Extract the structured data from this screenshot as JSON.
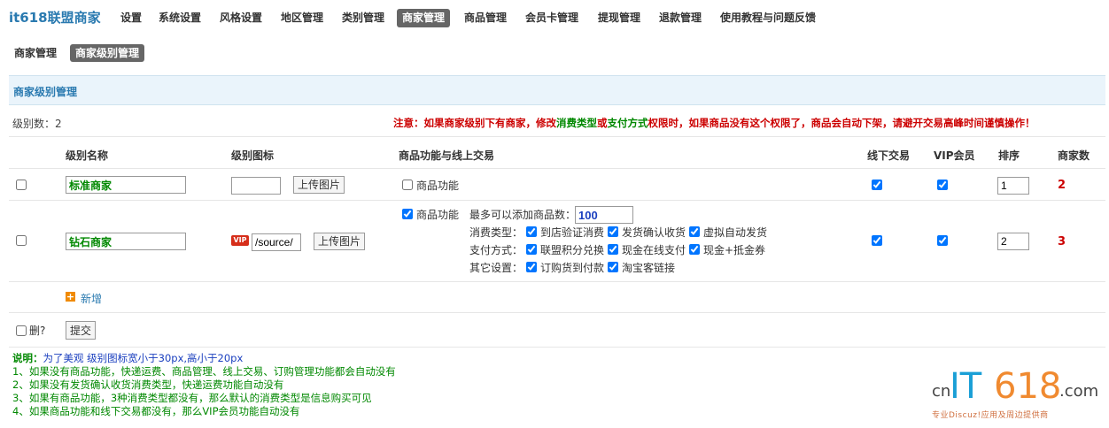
{
  "brand": "it618联盟商家",
  "nav": [
    "设置",
    "系统设置",
    "风格设置",
    "地区管理",
    "类别管理",
    "商家管理",
    "商品管理",
    "会员卡管理",
    "提现管理",
    "退款管理",
    "使用教程与问题反馈"
  ],
  "subnav": [
    "商家管理",
    "商家级别管理"
  ],
  "section_title": "商家级别管理",
  "level_count": "级别数：2",
  "notice": {
    "part1": "注意：如果商家级别下有商家，修改",
    "part2": "消费类型",
    "part3": "或",
    "part4": "支付方式",
    "part5": "权限时，如果商品没有这个权限了，商品会自动下架，请避开交易高峰时间谨慎操作！"
  },
  "columns": {
    "name": "级别名称",
    "icon": "级别图标",
    "func": "商品功能与线上交易",
    "offline": "线下交易",
    "vip": "VIP会员",
    "order": "排序",
    "count": "商家数"
  },
  "rows": [
    {
      "name": "标准商家",
      "upload": "上传图片",
      "func_label": "商品功能",
      "order": "1",
      "count": "2"
    },
    {
      "name": "钻石商家",
      "icon_path": "/source/",
      "vip_badge": "VIP",
      "upload": "上传图片",
      "func_label": "商品功能",
      "max_label": "最多可以添加商品数：",
      "max_value": "100",
      "consume_label": "消费类型：",
      "consume_opts": [
        "到店验证消费",
        "发货确认收货",
        "虚拟自动发货"
      ],
      "pay_label": "支付方式：",
      "pay_opts": [
        "联盟积分兑换",
        "现金在线支付",
        "现金+抵金券"
      ],
      "other_label": "其它设置：",
      "other_opts": [
        "订购货到付款",
        "淘宝客链接"
      ],
      "order": "2",
      "count": "3"
    }
  ],
  "add_label": "新增",
  "delete_label": "删?",
  "submit_label": "提交",
  "notes": {
    "title": "说明：",
    "title_rest": "为了美观 级别图标宽小于30px,高小于20px",
    "lines": [
      "1、如果没有商品功能，快递运费、商品管理、线上交易、订购管理功能都会自动没有",
      "2、如果没有发货确认收货消费类型，快递运费功能自动没有",
      "3、如果有商品功能，3种消费类型都没有，那么默认的消费类型是信息购买可见",
      "4、如果商品功能和线下交易都没有，那么VIP会员功能自动没有"
    ]
  },
  "watermark": {
    "cn": "cn",
    "it": "IT",
    "num": "618",
    "com": ".com",
    "sub": "专业Discuz!应用及周边提供商"
  }
}
